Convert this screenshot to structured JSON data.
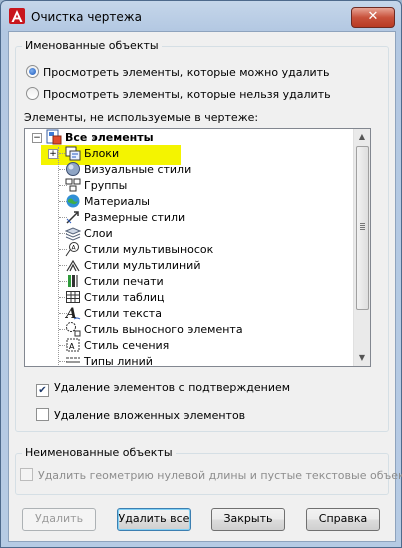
{
  "window": {
    "title": "Очистка чертежа",
    "close_glyph": "✕",
    "app_icon": "autocad-logo-icon"
  },
  "named_objects": {
    "caption": "Именованные объекты",
    "radio_purgeable": "Просмотреть элементы, которые можно удалить",
    "radio_nonpurgeable": "Просмотреть элементы, которые нельзя удалить",
    "selected_radio": "purgeable",
    "list_label": "Элементы, не используемые в чертеже:"
  },
  "tree": {
    "root": "Все элементы",
    "items": [
      {
        "label": "Блоки",
        "icon": "blocks-icon",
        "expandable": true,
        "highlighted": true
      },
      {
        "label": "Визуальные стили",
        "icon": "visual-styles-icon"
      },
      {
        "label": "Группы",
        "icon": "groups-icon"
      },
      {
        "label": "Материалы",
        "icon": "materials-icon"
      },
      {
        "label": "Размерные стили",
        "icon": "dimension-styles-icon"
      },
      {
        "label": "Слои",
        "icon": "layers-icon"
      },
      {
        "label": "Стили мультивыносок",
        "icon": "multileader-styles-icon"
      },
      {
        "label": "Стили мультилиний",
        "icon": "multiline-styles-icon"
      },
      {
        "label": "Стили печати",
        "icon": "plot-styles-icon"
      },
      {
        "label": "Стили таблиц",
        "icon": "table-styles-icon"
      },
      {
        "label": "Стили текста",
        "icon": "text-styles-icon"
      },
      {
        "label": "Стиль выносного элемента",
        "icon": "detail-view-style-icon"
      },
      {
        "label": "Стиль сечения",
        "icon": "section-view-style-icon"
      },
      {
        "label": "Типы линий",
        "icon": "linetypes-icon"
      }
    ]
  },
  "options": {
    "confirm_label": "Удаление элементов с подтверждением",
    "confirm_checked": true,
    "nested_label": "Удаление вложенных элементов",
    "nested_checked": false
  },
  "unnamed_objects": {
    "caption": "Неименованные объекты",
    "zero_length_label": "Удалить геометрию нулевой длины и пустые текстовые объекты"
  },
  "buttons": {
    "purge": "Удалить",
    "purge_all": "Удалить все",
    "close": "Закрыть",
    "help": "Справка"
  }
}
